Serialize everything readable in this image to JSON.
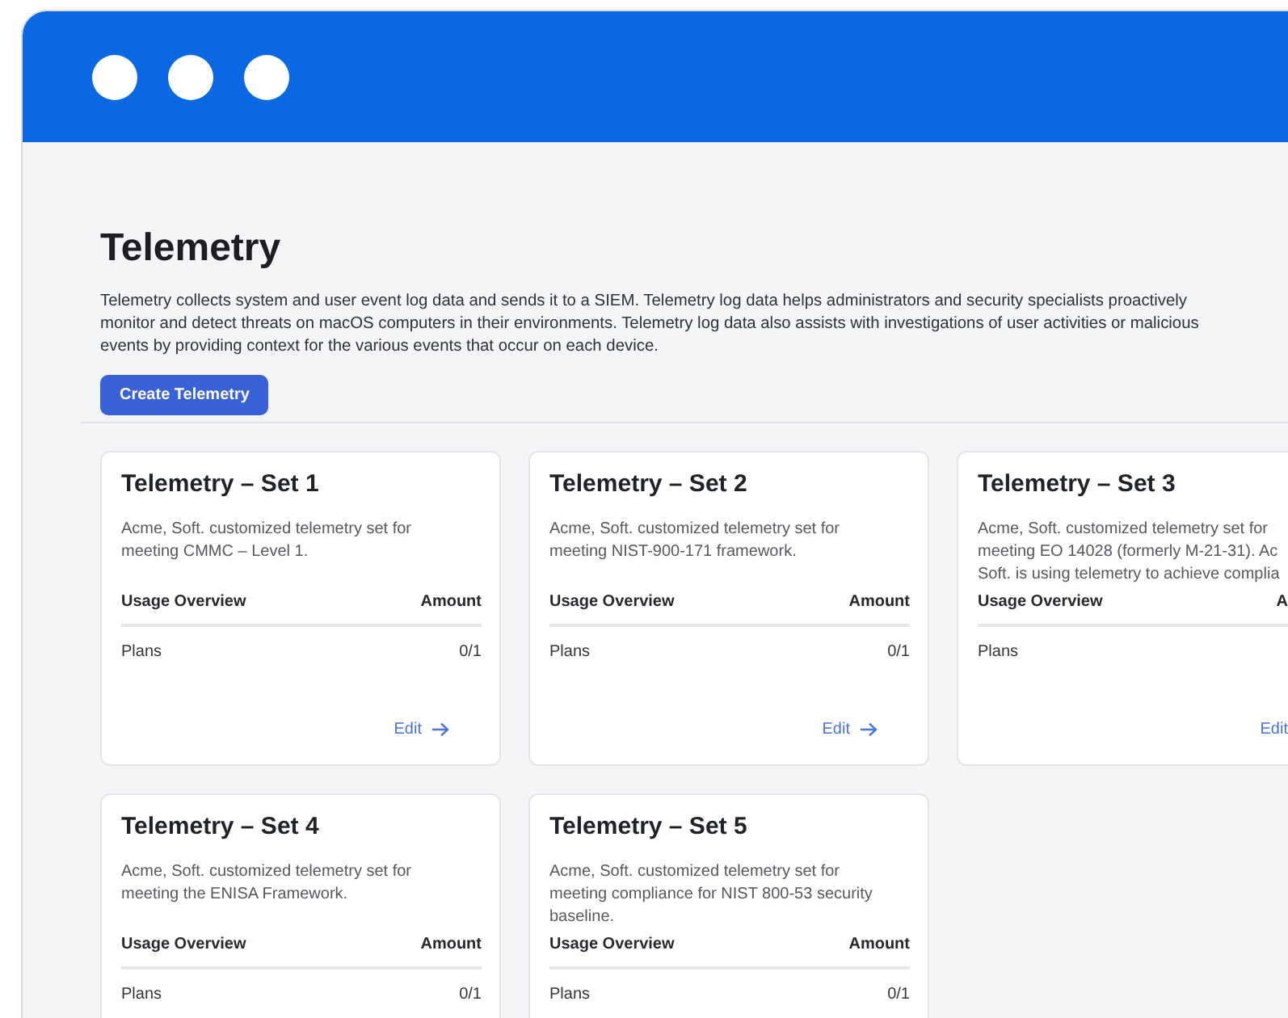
{
  "page": {
    "title": "Telemetry",
    "description": "Telemetry collects system and user event log data and sends it to a SIEM. Telemetry log data helps administrators and security specialists proactively monitor and detect threats on macOS computers in their environments. Telemetry log data also assists with investigations of user activities or malicious events by providing context for the various events that occur on each device.",
    "button": "Create Telemetry"
  },
  "cards": [
    {
      "title": "Telemetry – Set 1",
      "description_lines": [
        "Acme, Soft. customized telemetry set for",
        "meeting CMMC – Level 1."
      ],
      "col_usage": "Usage Overview",
      "col_amount": "Amount",
      "row_label": "Plans",
      "row_amount": "0/1",
      "edit": {
        "label": "Edit",
        "arrow": true
      }
    },
    {
      "title": "Telemetry – Set 2",
      "description_lines": [
        "Acme, Soft. customized telemetry set for",
        "meeting NIST-900-171 framework."
      ],
      "col_usage": "Usage Overview",
      "col_amount": "Amount",
      "row_label": "Plans",
      "row_amount": "0/1",
      "edit": {
        "label": "Edit",
        "arrow": true
      }
    },
    {
      "title": "Telemetry – Set 3",
      "description_lines": [
        "Acme, Soft. customized telemetry set for",
        "meeting EO 14028 (formerly M-21-31). Ac",
        "Soft. is using telemetry to achieve complia"
      ],
      "col_usage": "Usage Overview",
      "col_amount": "A",
      "row_label": "Plans",
      "edit": {
        "label": "Edit",
        "arrow": false
      }
    },
    {
      "title": "Telemetry – Set 4",
      "description_lines": [
        "Acme, Soft. customized telemetry set for",
        "meeting the ENISA Framework."
      ],
      "col_usage": "Usage Overview",
      "col_amount": "Amount",
      "row_label": "Plans",
      "row_amount": "0/1"
    },
    {
      "title": "Telemetry – Set 5",
      "description_lines": [
        "Acme, Soft. customized telemetry set for",
        "meeting compliance for NIST 800-53 security",
        "baseline."
      ],
      "col_usage": "Usage Overview",
      "col_amount": "Amount",
      "row_label": "Plans",
      "row_amount": "0/1"
    }
  ]
}
